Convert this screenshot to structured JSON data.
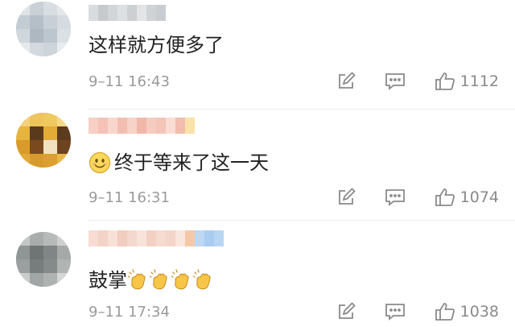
{
  "comments": [
    {
      "text": "这样就方便多了",
      "time": "9–11 16:43",
      "likes": "1112",
      "has_face_emoji": false,
      "claps": 0
    },
    {
      "text": "终于等来了这一天",
      "time": "9–11 16:31",
      "likes": "1074",
      "has_face_emoji": true,
      "claps": 0
    },
    {
      "text": "鼓掌",
      "time": "9–11 17:34",
      "likes": "1038",
      "has_face_emoji": false,
      "claps": 4
    }
  ],
  "icons": {
    "repost": "repost-icon",
    "reply": "reply-icon",
    "like": "thumbs-up-icon"
  },
  "colors": {
    "time": "#9a9a9a",
    "icon": "#8a8a8a",
    "divider": "#ececec",
    "text": "#222222"
  }
}
